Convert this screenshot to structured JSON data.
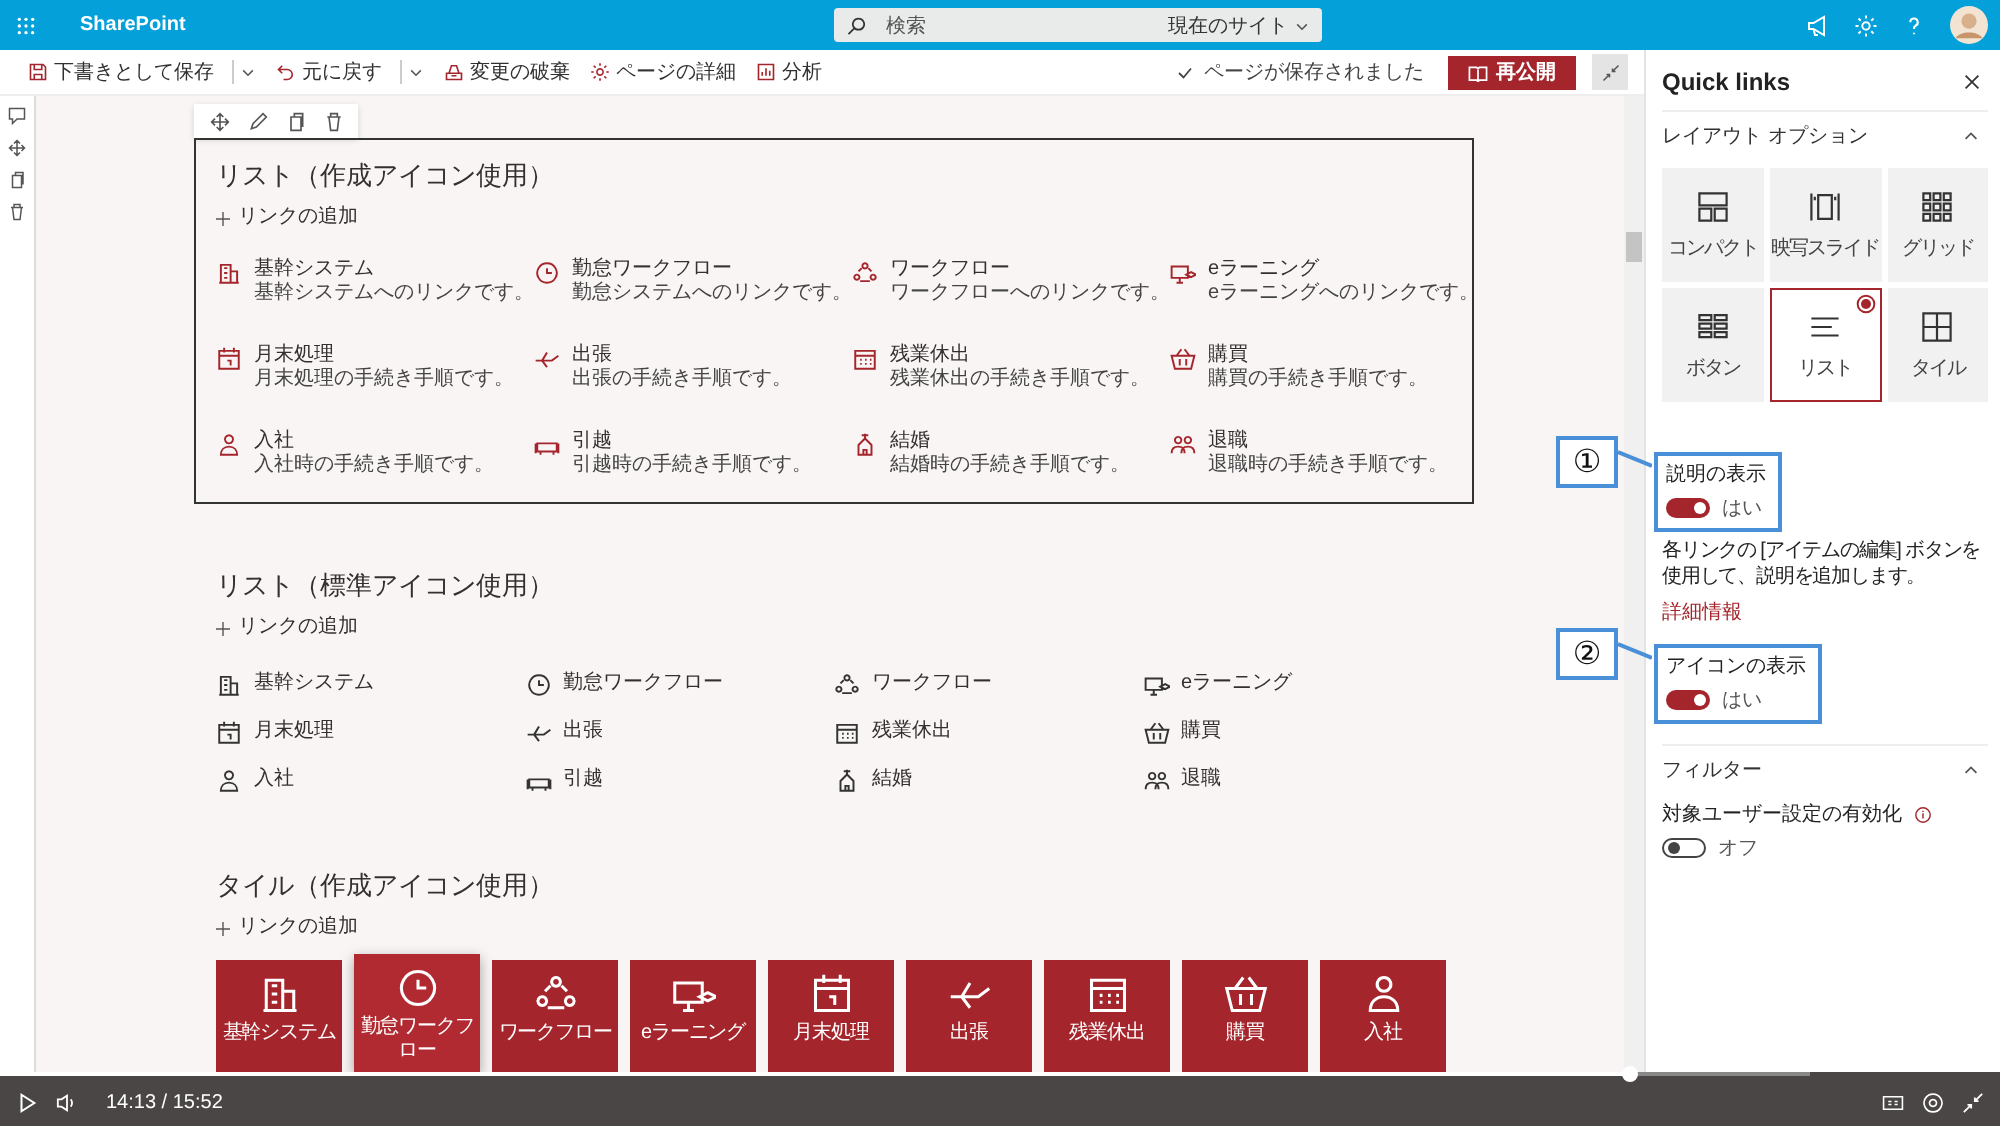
{
  "top_bar": {
    "app_name": "SharePoint",
    "search": {
      "placeholder": "検索",
      "scope": "現在のサイト"
    }
  },
  "toolbar": {
    "items": [
      {
        "label": "下書きとして保存",
        "kind": "save",
        "menu": true
      },
      {
        "label": "元に戻す",
        "kind": "undo",
        "menu": true
      },
      {
        "label": "変更の破棄",
        "kind": "discard",
        "menu": false
      },
      {
        "label": "ページの詳細",
        "kind": "details",
        "menu": false
      },
      {
        "label": "分析",
        "kind": "analytics",
        "menu": false
      }
    ],
    "status": "ページが保存されました",
    "publish_button": "再公開"
  },
  "sections": [
    {
      "title": "リスト（作成アイコン使用）",
      "add_link": "リンクの追加",
      "kind": "customlist",
      "selected": true,
      "items": [
        {
          "title": "基幹システム",
          "description": "基幹システムへのリンクです。"
        },
        {
          "title": "勤怠ワークフロー",
          "description": "勤怠システムへのリンクです。"
        },
        {
          "title": "ワークフロー",
          "description": "ワークフローへのリンクです。"
        },
        {
          "title": "eラーニング",
          "description": "eラーニングへのリンクです。"
        },
        {
          "title": "月末処理",
          "description": "月末処理の手続き手順です。"
        },
        {
          "title": "出張",
          "description": "出張の手続き手順です。"
        },
        {
          "title": "残業休出",
          "description": "残業休出の手続き手順です。"
        },
        {
          "title": "購買",
          "description": "購買の手続き手順です。"
        },
        {
          "title": "入社",
          "description": "入社時の手続き手順です。"
        },
        {
          "title": "引越",
          "description": "引越時の手続き手順です。"
        },
        {
          "title": "結婚",
          "description": "結婚時の手続き手順です。"
        },
        {
          "title": "退職",
          "description": "退職時の手続き手順です。"
        }
      ]
    },
    {
      "title": "リスト（標準アイコン使用）",
      "add_link": "リンクの追加",
      "kind": "standardlist",
      "selected": false,
      "items": [
        {
          "title": "基幹システム"
        },
        {
          "title": "勤怠ワークフロー"
        },
        {
          "title": "ワークフロー"
        },
        {
          "title": "eラーニング"
        },
        {
          "title": "月末処理"
        },
        {
          "title": "出張"
        },
        {
          "title": "残業休出"
        },
        {
          "title": "購買"
        },
        {
          "title": "入社"
        },
        {
          "title": "引越"
        },
        {
          "title": "結婚"
        },
        {
          "title": "退職"
        }
      ]
    },
    {
      "title": "タイル（作成アイコン使用）",
      "add_link": "リンクの追加",
      "kind": "tiles",
      "selected": false,
      "items": [
        {
          "title": "基幹システム",
          "kind": "full",
          "hovered": false
        },
        {
          "title": "勤怠ワークフロー",
          "kind": "full",
          "hovered": true
        },
        {
          "title": "ワークフロー",
          "kind": "full",
          "hovered": false
        },
        {
          "title": "eラーニング",
          "kind": "full",
          "hovered": false
        },
        {
          "title": "月末処理",
          "kind": "full",
          "hovered": false
        },
        {
          "title": "出張",
          "kind": "full",
          "hovered": false
        },
        {
          "title": "残業休出",
          "kind": "full",
          "hovered": false
        },
        {
          "title": "購買",
          "kind": "full",
          "hovered": false
        },
        {
          "title": "入社",
          "kind": "full",
          "hovered": false
        }
      ]
    }
  ],
  "panel": {
    "title": "Quick links",
    "layout_heading": "レイアウト オプション",
    "layout_options": [
      {
        "label": "コンパクト",
        "selected": false
      },
      {
        "label": "映写スライド",
        "selected": false
      },
      {
        "label": "グリッド",
        "selected": false
      },
      {
        "label": "ボタン",
        "selected": false
      },
      {
        "label": "リスト",
        "selected": true
      },
      {
        "label": "タイル",
        "selected": false
      }
    ],
    "show_description": {
      "label": "説明の表示",
      "on": true,
      "state_text": "はい"
    },
    "help_text": "各リンクの [アイテムの編集] ボタンを使用して、説明を追加します。",
    "more_link": "詳細情報",
    "show_icons": {
      "label": "アイコンの表示",
      "on": true,
      "state_text": "はい"
    },
    "filter_heading": "フィルター",
    "audience": {
      "label": "対象ユーザー設定の有効化",
      "on": false,
      "state_text": "オフ"
    }
  },
  "annotations": [
    {
      "number": "①"
    },
    {
      "number": "②"
    }
  ],
  "player": {
    "time": "14:13 / 15:52",
    "level": 0.9
  }
}
